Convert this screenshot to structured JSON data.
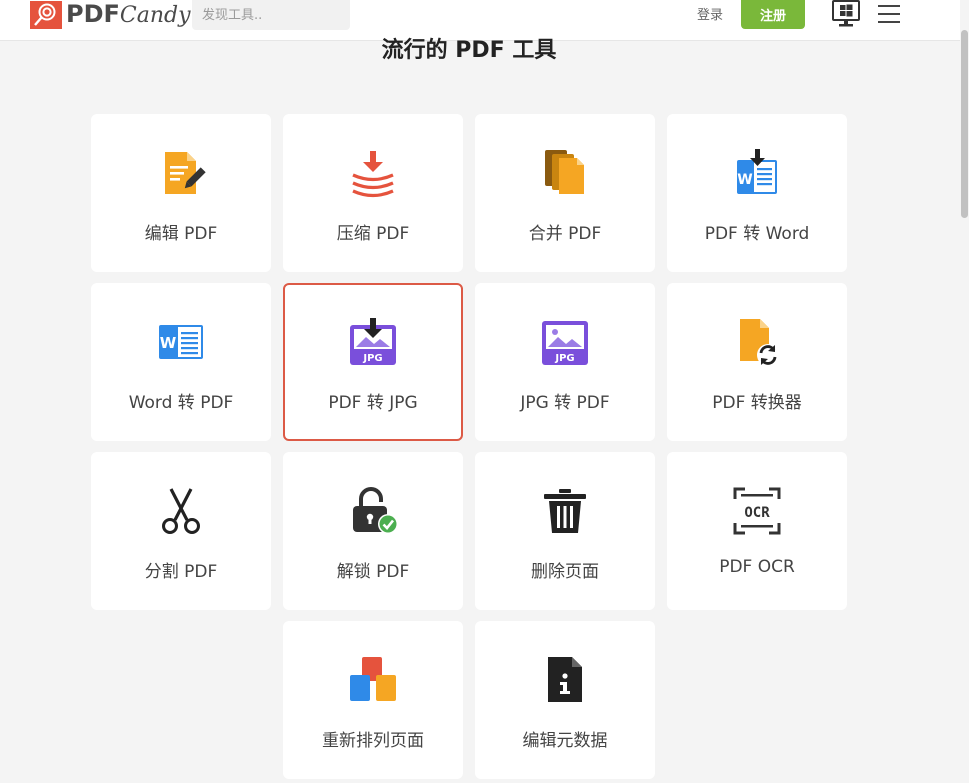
{
  "header": {
    "logo_text_bold": "PDF",
    "logo_text_script": "Candy",
    "search_placeholder": "发现工具..",
    "login_label": "登录",
    "register_label": "注册",
    "windows_icon": "windows-desktop-icon",
    "menu_icon": "hamburger-menu-icon"
  },
  "main": {
    "heading": "流行的 PDF 工具",
    "tools": [
      {
        "label": "编辑 PDF",
        "icon": "edit-pdf-icon"
      },
      {
        "label": "压缩 PDF",
        "icon": "compress-pdf-icon"
      },
      {
        "label": "合并 PDF",
        "icon": "merge-pdf-icon"
      },
      {
        "label": "PDF 转 Word",
        "icon": "pdf-to-word-icon"
      },
      {
        "label": "Word 转 PDF",
        "icon": "word-icon"
      },
      {
        "label": "PDF 转 JPG",
        "icon": "pdf-to-jpg-icon",
        "active": true
      },
      {
        "label": "JPG 转 PDF",
        "icon": "jpg-icon"
      },
      {
        "label": "PDF 转换器",
        "icon": "pdf-converter-icon"
      },
      {
        "label": "分割 PDF",
        "icon": "scissors-icon"
      },
      {
        "label": "解锁 PDF",
        "icon": "unlock-icon"
      },
      {
        "label": "删除页面",
        "icon": "trash-icon"
      },
      {
        "label": "PDF OCR",
        "icon": "ocr-icon"
      },
      {
        "label": "重新排列页面",
        "icon": "rearrange-pages-icon"
      },
      {
        "label": "编辑元数据",
        "icon": "metadata-info-icon"
      }
    ]
  },
  "colors": {
    "accent_green": "#7ab83a",
    "active_border": "#dc5a46",
    "brand_red": "#e5533d",
    "orange": "#f5a623",
    "blue": "#2f8ae8",
    "purple": "#7a4fdb"
  }
}
